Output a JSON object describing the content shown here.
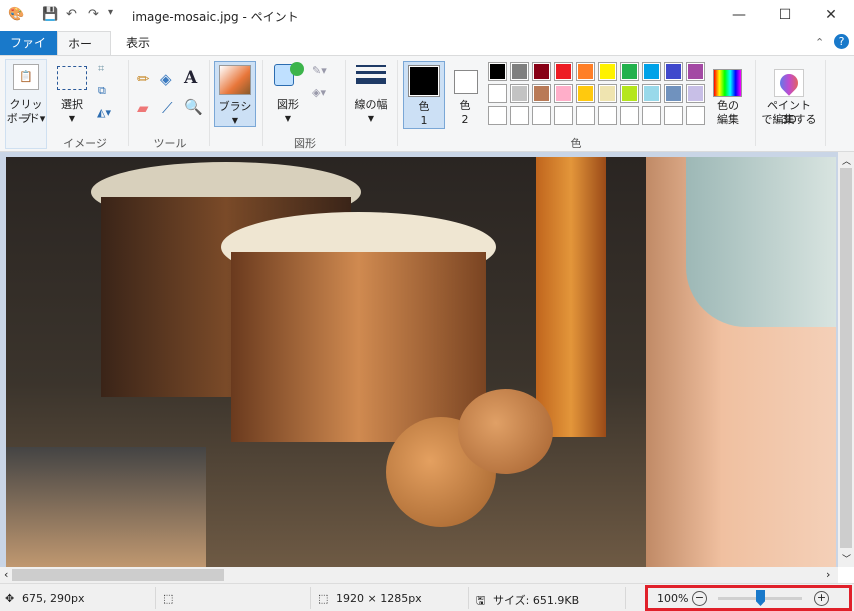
{
  "window": {
    "title": "image-mosaic.jpg - ペイント",
    "minimize": "—",
    "maximize": "☐",
    "close": "✕"
  },
  "tabs": [
    {
      "label": "ファイル"
    },
    {
      "label": "ホーム"
    },
    {
      "label": "表示"
    }
  ],
  "ribbon": {
    "clipboard": {
      "label": "クリップ",
      "label2": "ボード▾"
    },
    "image": {
      "select_label": "選択",
      "group": "イメージ"
    },
    "tools": {
      "group": "ツール"
    },
    "brush": {
      "label": "ブラシ"
    },
    "shapes": {
      "label": "図形",
      "group": "図形"
    },
    "size": {
      "label": "線の幅"
    },
    "color1": {
      "label": "色",
      "num": "1",
      "value": "#000000"
    },
    "color2": {
      "label": "色",
      "num": "2",
      "value": "#ffffff"
    },
    "palette_row1": [
      "#000000",
      "#7f7f7f",
      "#880015",
      "#ed1c24",
      "#ff7f27",
      "#fff200",
      "#22b14c",
      "#00a2e8",
      "#3f48cc",
      "#a349a4"
    ],
    "palette_row2": [
      "#ffffff",
      "#c3c3c3",
      "#b97a57",
      "#ffaec9",
      "#ffc90e",
      "#efe4b0",
      "#b5e61d",
      "#99d9ea",
      "#7092be",
      "#c8bfe7"
    ],
    "colors_group": "色",
    "edit_colors": {
      "label": "色の",
      "label2": "編集"
    },
    "paint3d": {
      "label": "ペイント 3D",
      "label2": "で編集する"
    }
  },
  "status": {
    "cursor": "675, 290px",
    "image_size": "1920 × 1285px",
    "file_size": "サイズ: 651.9KB",
    "zoom": "100%",
    "zoom_level_percent": 100
  }
}
